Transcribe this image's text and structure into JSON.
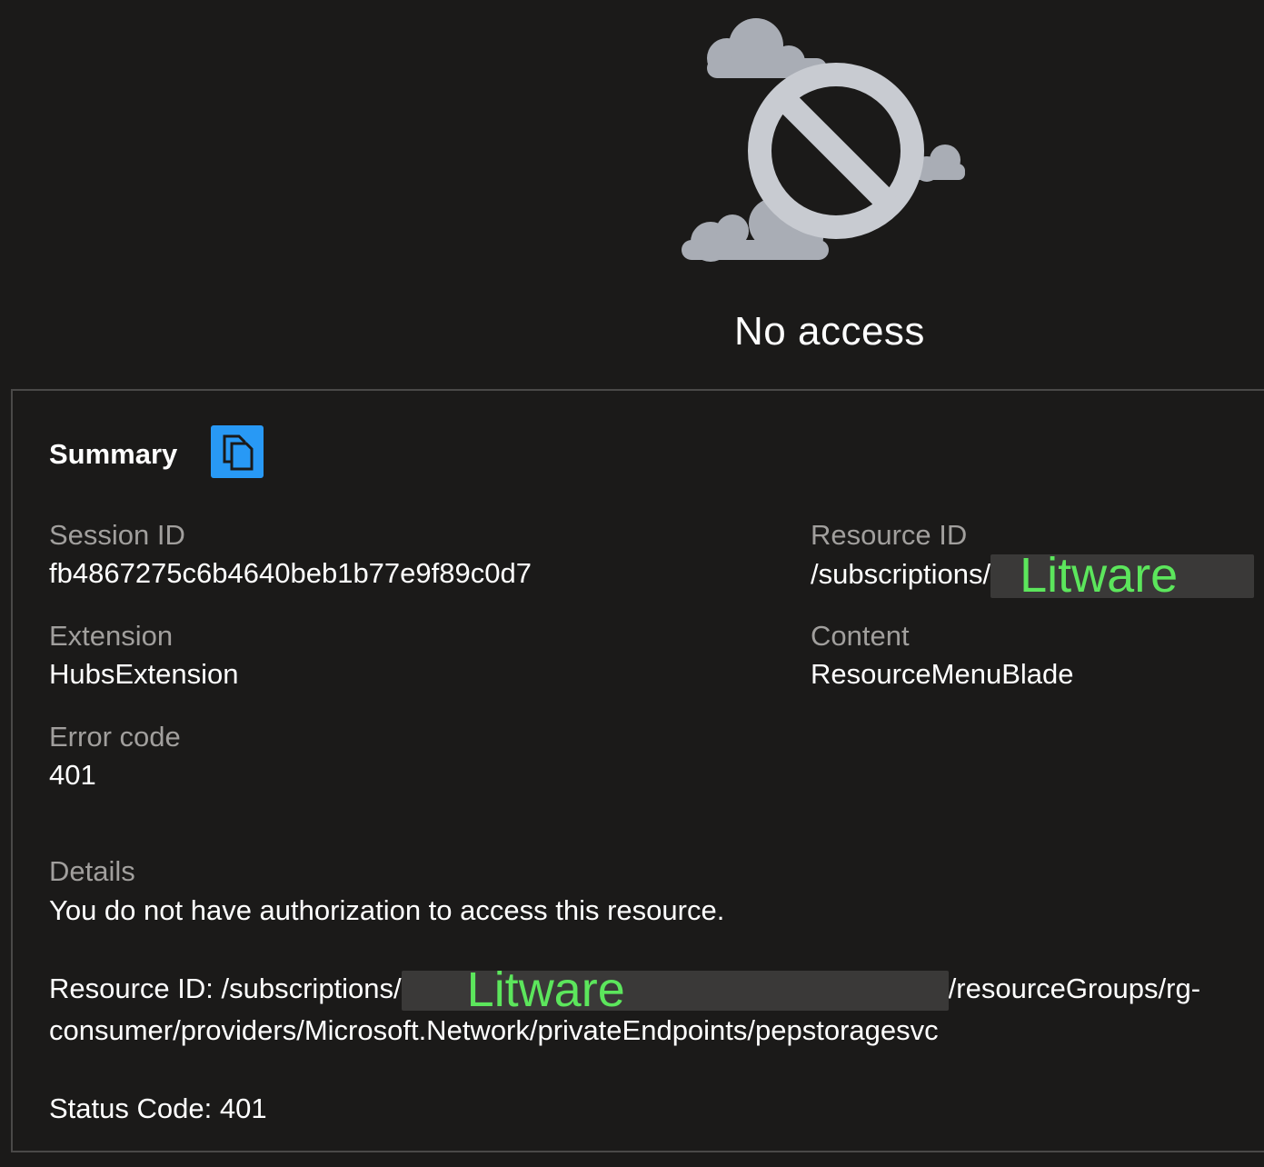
{
  "hero": {
    "title": "No access",
    "icon": "blocked-cloud-icon"
  },
  "summary": {
    "title": "Summary",
    "copy_icon": "copy-icon"
  },
  "fields": {
    "session_id": {
      "label": "Session ID",
      "value": "fb4867275c6b4640beb1b77e9f89c0d7"
    },
    "resource_id": {
      "label": "Resource ID",
      "value_prefix": "/subscriptions/",
      "redaction_text": "Litware"
    },
    "extension": {
      "label": "Extension",
      "value": "HubsExtension"
    },
    "content": {
      "label": "Content",
      "value": "ResourceMenuBlade"
    },
    "error_code": {
      "label": "Error code",
      "value": "401"
    }
  },
  "details": {
    "label": "Details",
    "message": "You do not have authorization to access this resource.",
    "resource_prefix": "Resource ID: /subscriptions/",
    "redaction_text": "Litware",
    "resource_suffix": "/resourceGroups/rg-consumer/providers/Microsoft.Network/privateEndpoints/pepstoragesvc",
    "status": "Status Code: 401"
  },
  "colors": {
    "background": "#1b1a19",
    "accent": "#2899f5",
    "label": "#a19f9d",
    "watermark": "#5ce65c"
  }
}
